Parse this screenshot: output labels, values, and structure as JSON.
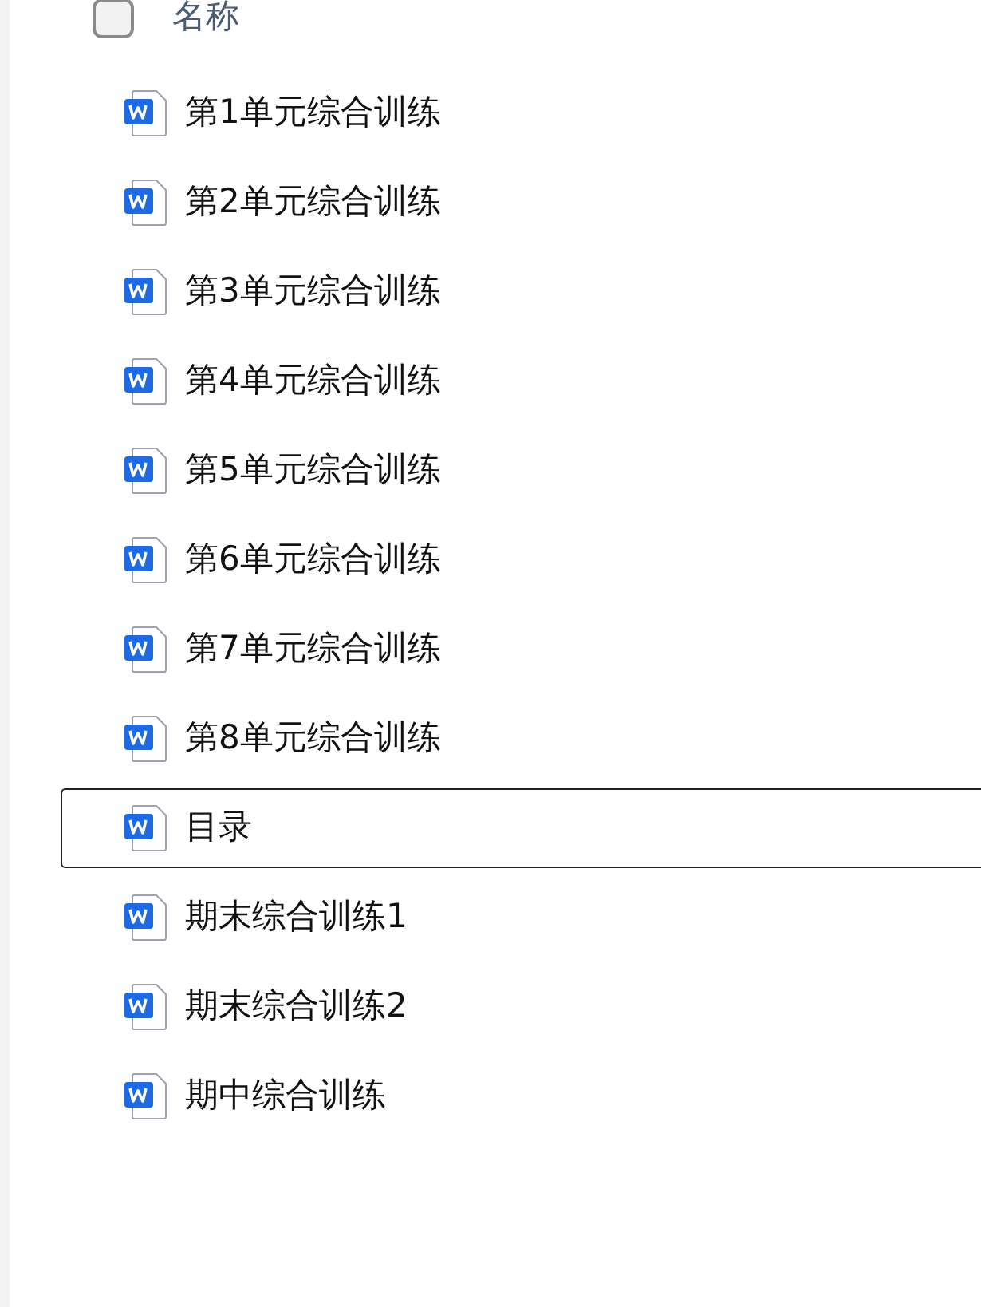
{
  "header": {
    "checkbox": {
      "checked": false
    },
    "label": "名称"
  },
  "files": [
    {
      "name": "第1单元综合训练",
      "selected": false
    },
    {
      "name": "第2单元综合训练",
      "selected": false
    },
    {
      "name": "第3单元综合训练",
      "selected": false
    },
    {
      "name": "第4单元综合训练",
      "selected": false
    },
    {
      "name": "第5单元综合训练",
      "selected": false
    },
    {
      "name": "第6单元综合训练",
      "selected": false
    },
    {
      "name": "第7单元综合训练",
      "selected": false
    },
    {
      "name": "第8单元综合训练",
      "selected": false
    },
    {
      "name": "目录",
      "selected": true
    },
    {
      "name": "期末综合训练1",
      "selected": false
    },
    {
      "name": "期末综合训练2",
      "selected": false
    },
    {
      "name": "期中综合训练",
      "selected": false
    }
  ]
}
